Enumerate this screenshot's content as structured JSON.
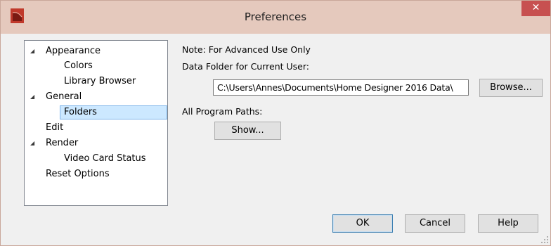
{
  "window": {
    "title": "Preferences",
    "close_glyph": "✕",
    "icon": "app-logo-icon"
  },
  "tree": {
    "expand_glyph": "◢",
    "items": [
      {
        "label": "Appearance",
        "level": 0,
        "expanded": true
      },
      {
        "label": "Colors",
        "level": 1
      },
      {
        "label": "Library Browser",
        "level": 1
      },
      {
        "label": "General",
        "level": 0,
        "expanded": true
      },
      {
        "label": "Folders",
        "level": 1,
        "selected": true
      },
      {
        "label": "Edit",
        "level": 0
      },
      {
        "label": "Render",
        "level": 0,
        "expanded": true
      },
      {
        "label": "Video Card Status",
        "level": 1
      },
      {
        "label": "Reset Options",
        "level": 0
      }
    ]
  },
  "panel": {
    "note": "Note: For Advanced Use Only",
    "data_folder_label": "Data Folder for Current User:",
    "data_folder_value": "C:\\Users\\Annes\\Documents\\Home Designer 2016 Data\\",
    "browse_label": "Browse...",
    "program_paths_label": "All Program Paths:",
    "show_label": "Show..."
  },
  "buttons": {
    "ok": "OK",
    "cancel": "Cancel",
    "help": "Help"
  },
  "colors": {
    "title_bar": "#e5c9bd",
    "close_button": "#c75050",
    "selection": "#cce8ff",
    "default_button_border": "#3c7fb1"
  }
}
